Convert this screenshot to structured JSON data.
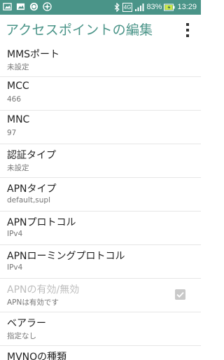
{
  "status_bar": {
    "battery_percent": "83%",
    "time": "13:29",
    "network": "4G",
    "left_icons": [
      "photo-icon",
      "image-icon",
      "sync-icon",
      "compass-icon"
    ],
    "colors": {
      "background": "#4a9488",
      "battery_charge": "#c8e64a"
    }
  },
  "app_bar": {
    "title": "アクセスポイントの編集",
    "overflow_icon": "more-vert-icon",
    "title_color": "#4a9488"
  },
  "settings": [
    {
      "title": "MMSポート",
      "summary": "未設定"
    },
    {
      "title": "MCC",
      "summary": "466"
    },
    {
      "title": "MNC",
      "summary": "97"
    },
    {
      "title": "認証タイプ",
      "summary": "未設定"
    },
    {
      "title": "APNタイプ",
      "summary": "default,supl"
    },
    {
      "title": "APNプロトコル",
      "summary": "IPv4"
    },
    {
      "title": "APNローミングプロトコル",
      "summary": "IPv4"
    },
    {
      "title": "APNの有効/無効",
      "summary": "APNは有効です",
      "checked": true,
      "disabled": true
    },
    {
      "title": "ベアラー",
      "summary": "指定なし"
    },
    {
      "title": "MVNOの種類"
    }
  ]
}
